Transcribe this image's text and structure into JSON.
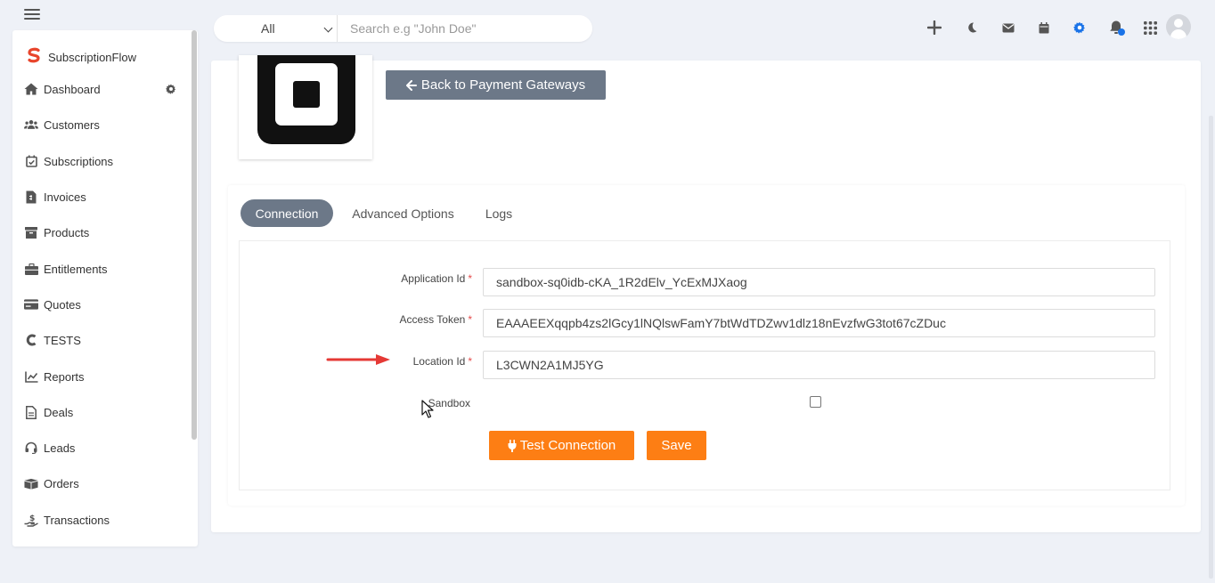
{
  "topbar": {
    "search_select": "All",
    "search_placeholder": "Search e.g \"John Doe\""
  },
  "sidebar": {
    "brand": "SubscriptionFlow",
    "items": [
      {
        "label": "Dashboard",
        "icon": "home-icon"
      },
      {
        "label": "Customers",
        "icon": "users-icon"
      },
      {
        "label": "Subscriptions",
        "icon": "calendar-check-icon"
      },
      {
        "label": "Invoices",
        "icon": "invoice-icon"
      },
      {
        "label": "Products",
        "icon": "box-icon"
      },
      {
        "label": "Entitlements",
        "icon": "toolbox-icon"
      },
      {
        "label": "Quotes",
        "icon": "card-icon"
      },
      {
        "label": "TESTS",
        "icon": "c-icon"
      },
      {
        "label": "Reports",
        "icon": "chart-icon"
      },
      {
        "label": "Deals",
        "icon": "file-icon"
      },
      {
        "label": "Leads",
        "icon": "headset-icon"
      },
      {
        "label": "Orders",
        "icon": "boxes-icon"
      },
      {
        "label": "Transactions",
        "icon": "hand-dollar-icon"
      }
    ]
  },
  "main": {
    "back_button": "Back to Payment Gateways",
    "tabs": [
      "Connection",
      "Advanced Options",
      "Logs"
    ],
    "form": {
      "application_id_label": "Application Id",
      "application_id_value": "sandbox-sq0idb-cKA_1R2dElv_YcExMJXaog",
      "access_token_label": "Access Token",
      "access_token_value": "EAAAEEXqqpb4zs2lGcy1lNQlswFamY7btWdTDZwv1dlz18nEvzfwG3tot67cZDuc",
      "location_id_label": "Location Id",
      "location_id_value": "L3CWN2A1MJ5YG",
      "sandbox_label": "Sandbox",
      "required_mark": "*",
      "test_button": "Test Connection",
      "save_button": "Save"
    }
  },
  "colors": {
    "accent_orange": "#fd7e14",
    "tab_active": "#6c7888",
    "brand_red": "#e8452c",
    "notification_dot": "#1a73e8"
  }
}
